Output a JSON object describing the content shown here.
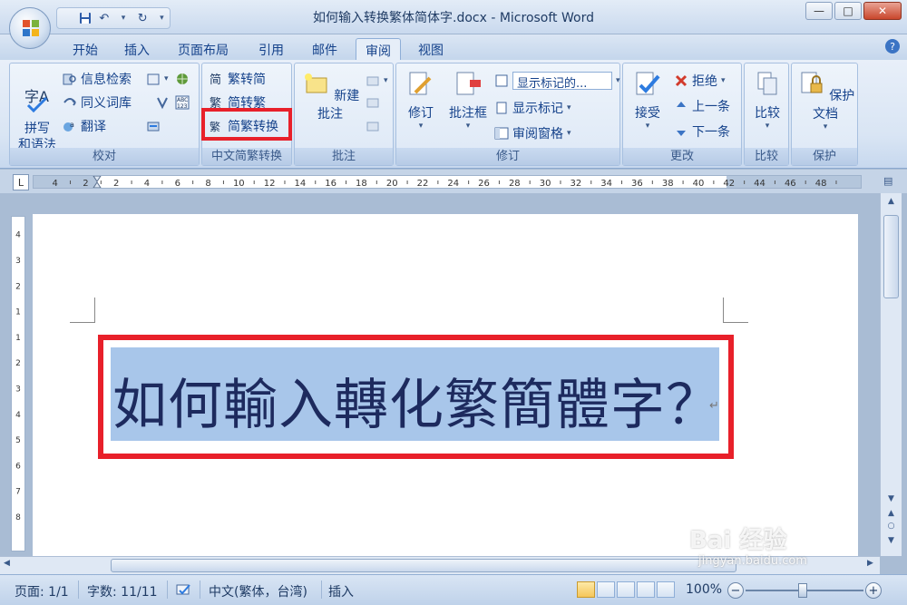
{
  "window": {
    "title": "如何输入转换繁体简体字.docx - Microsoft Word"
  },
  "qat": {
    "icons": [
      "save-icon",
      "undo-icon",
      "redo-icon",
      "customize-icon"
    ]
  },
  "tabs": [
    {
      "label": "开始",
      "active": false
    },
    {
      "label": "插入",
      "active": false
    },
    {
      "label": "页面布局",
      "active": false
    },
    {
      "label": "引用",
      "active": false
    },
    {
      "label": "邮件",
      "active": false
    },
    {
      "label": "审阅",
      "active": true
    },
    {
      "label": "视图",
      "active": false
    }
  ],
  "ribbon": {
    "proofing": {
      "label": "校对",
      "spelling": "拼写\n和语法",
      "research": "信息检索",
      "thesaurus": "同义词库",
      "translate": "翻译"
    },
    "chinese": {
      "label": "中文简繁转换",
      "to_simplified": "繁转简",
      "to_traditional": "简转繁",
      "convert": "简繁转换"
    },
    "comments": {
      "label": "批注",
      "new_comment": "新建批注"
    },
    "tracking": {
      "label": "修订",
      "track_changes": "修订",
      "balloons": "批注框",
      "display_dropdown": "显示标记的...",
      "show_markup": "显示标记",
      "reviewing_pane": "审阅窗格"
    },
    "changes": {
      "label": "更改",
      "accept": "接受",
      "reject": "拒绝",
      "previous": "上一条",
      "next": "下一条"
    },
    "compare": {
      "label": "比较"
    },
    "protect": {
      "label": "保护",
      "protect_doc": "保护文档"
    }
  },
  "ruler": {
    "h_numbers": [
      "4",
      "2",
      "2",
      "4",
      "6",
      "8",
      "10",
      "12",
      "14",
      "16",
      "18",
      "20",
      "22",
      "24",
      "26",
      "28",
      "30",
      "32",
      "34",
      "36",
      "38",
      "40",
      "42",
      "44",
      "46",
      "48"
    ],
    "v_numbers": [
      "4",
      "3",
      "2",
      "1",
      "1",
      "2",
      "3",
      "4",
      "5",
      "6",
      "7",
      "8"
    ]
  },
  "document": {
    "text": "如何輸入轉化繁簡體字？",
    "para_mark": "↵"
  },
  "status": {
    "page": "页面: 1/1",
    "words": "字数: 11/11",
    "language": "中文(繁体，台湾)",
    "mode": "插入",
    "zoom": "100%",
    "zoom_level": 100
  },
  "watermark": {
    "brand": "Bai  经验",
    "url": "jingyan.baidu.com"
  },
  "colors": {
    "highlight_box": "#e8202a",
    "selection": "#a8c6ea"
  }
}
